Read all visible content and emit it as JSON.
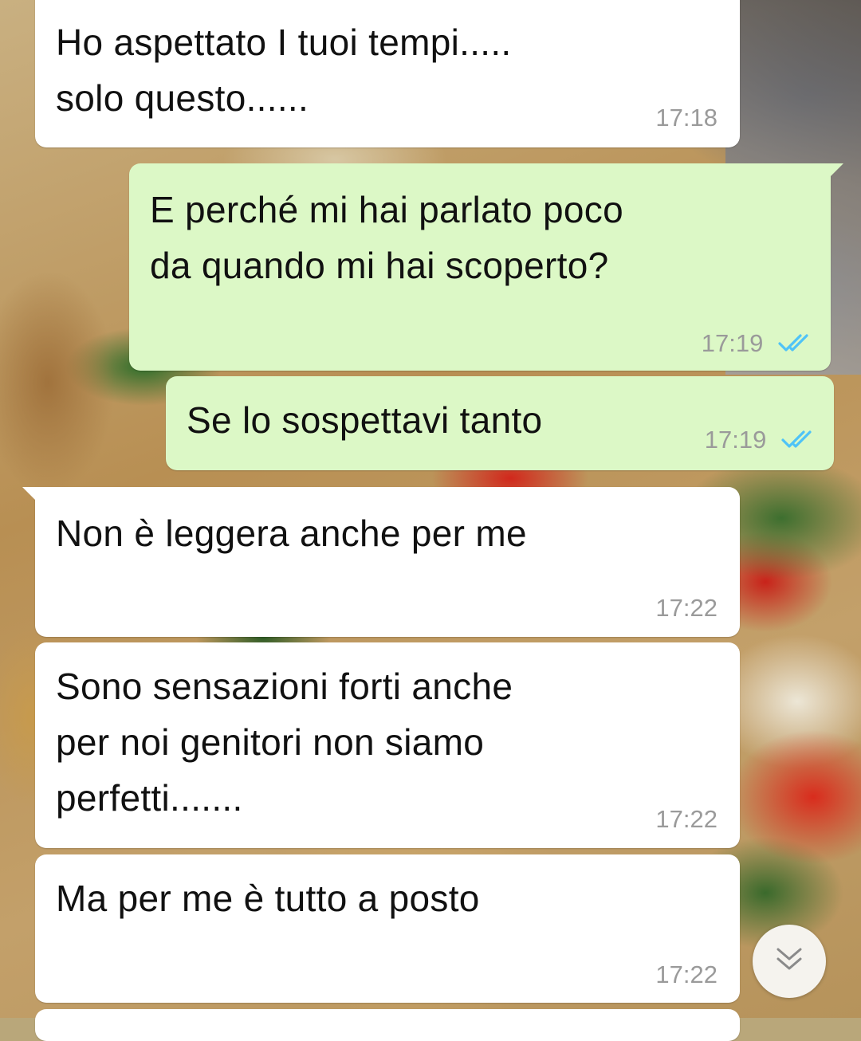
{
  "colors": {
    "incoming_bubble": "#ffffff",
    "outgoing_bubble": "#dcf8c6",
    "read_ticks": "#4fc3f7",
    "timestamp": "#9a9a9a"
  },
  "messages": [
    {
      "direction": "incoming",
      "text": "Ho aspettato I tuoi tempi.....\nsolo questo......",
      "time": "17:18"
    },
    {
      "direction": "outgoing",
      "text": "E perché mi hai parlato poco\nda quando mi hai scoperto?",
      "time": "17:19",
      "status": "read"
    },
    {
      "direction": "outgoing",
      "text": "Se lo sospettavi tanto",
      "time": "17:19",
      "status": "read"
    },
    {
      "direction": "incoming",
      "text": "Non è leggera anche per me",
      "time": "17:22"
    },
    {
      "direction": "incoming",
      "text": "Sono sensazioni forti anche\nper noi genitori non siamo\nperfetti.......",
      "time": "17:22"
    },
    {
      "direction": "incoming",
      "text": "Ma per me è tutto a posto",
      "time": "17:22"
    }
  ],
  "scroll_down_button": {
    "icon": "double-chevron-down-icon"
  }
}
